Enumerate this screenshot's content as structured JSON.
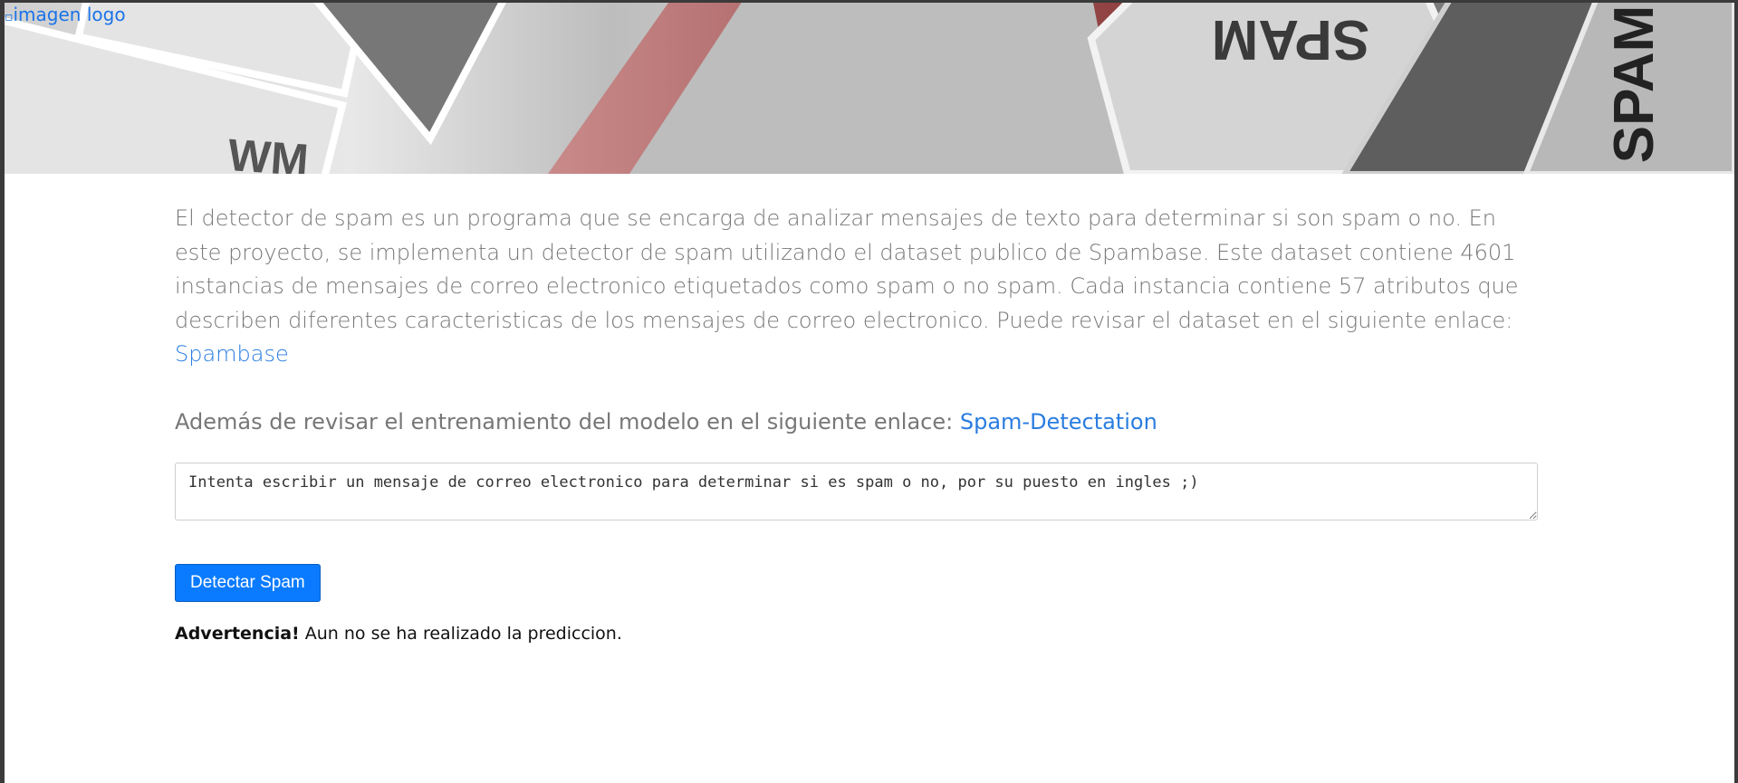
{
  "header": {
    "logo_alt": "imagen logo",
    "banner_words": [
      "SPAM",
      "SPAM",
      "SPAM"
    ]
  },
  "main": {
    "intro_text": "El detector de spam es un programa que se encarga de analizar mensajes de texto para determinar si son spam o no. En este proyecto, se implementa un detector de spam utilizando el dataset publico de Spambase. Este dataset contiene 4601 instancias de mensajes de correo electronico etiquetados como spam o no spam. Cada instancia contiene 57 atributos que describen diferentes caracteristicas de los mensajes de correo electronico. Puede revisar el dataset en el siguiente enlace: ",
    "spambase_link": "Spambase",
    "extra_text": "Además de revisar el entrenamiento del modelo en el siguiente enlace: ",
    "training_link": "Spam-Detectation",
    "message_placeholder": "Intenta escribir un mensaje de correo electronico para determinar si es spam o no, por su puesto en ingles ;)",
    "detect_button": "Detectar Spam",
    "warning_label": "Advertencia!",
    "warning_text": " Aun no se ha realizado la prediccion."
  },
  "colors": {
    "link": "#2a7de0",
    "button": "#0a7bff",
    "text_muted": "#777777"
  }
}
